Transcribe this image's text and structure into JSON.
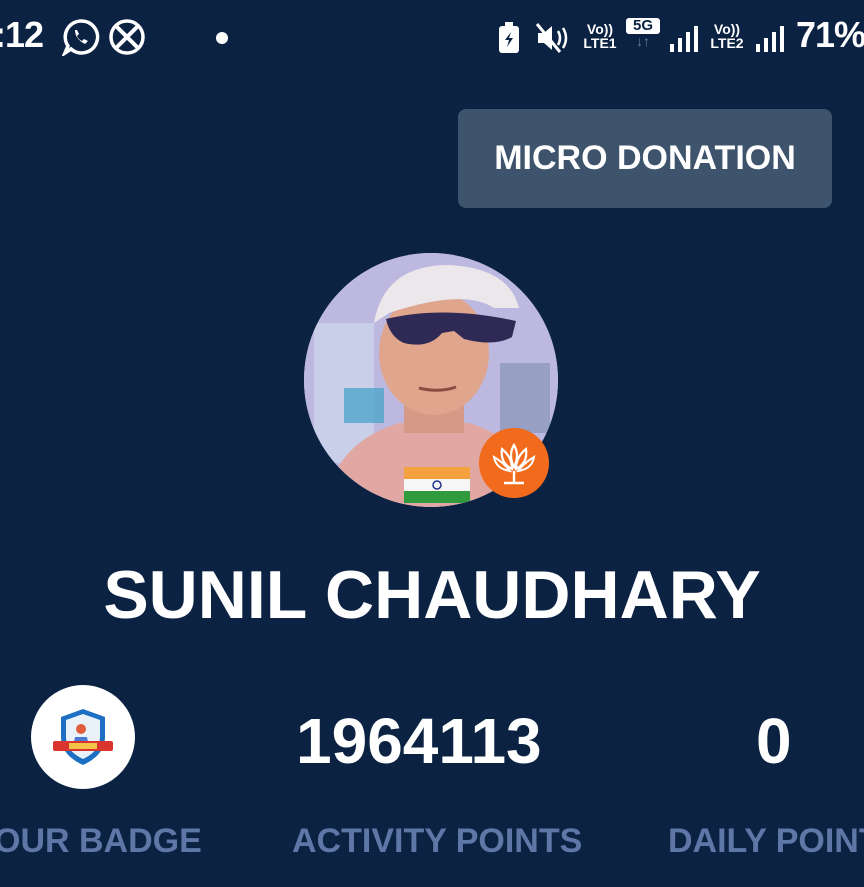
{
  "status_bar": {
    "time": ":12",
    "icons": [
      "whatsapp-icon",
      "crossed-x-icon",
      "battery-saver-icon",
      "mute-vibrate-icon",
      "signal-icon"
    ],
    "sim1_top": "Vo))",
    "sim1_bottom": "LTE1",
    "network_badge": "5G",
    "sim2_top": "Vo))",
    "sim2_bottom": "LTE2",
    "battery": "71%"
  },
  "header": {
    "micro_donation_label": "MICRO DONATION"
  },
  "profile": {
    "name": "SUNIL CHAUDHARY"
  },
  "stats": {
    "activity_points": "1964113",
    "daily_points": "0",
    "badge_label": "OUR BADGE",
    "activity_label": "ACTIVITY POINTS",
    "daily_label": "DAILY POINT"
  },
  "colors": {
    "background": "#0b2242",
    "button_bg": "#3e536c",
    "label": "#5e77a6",
    "party_orange": "#f26a1b"
  }
}
